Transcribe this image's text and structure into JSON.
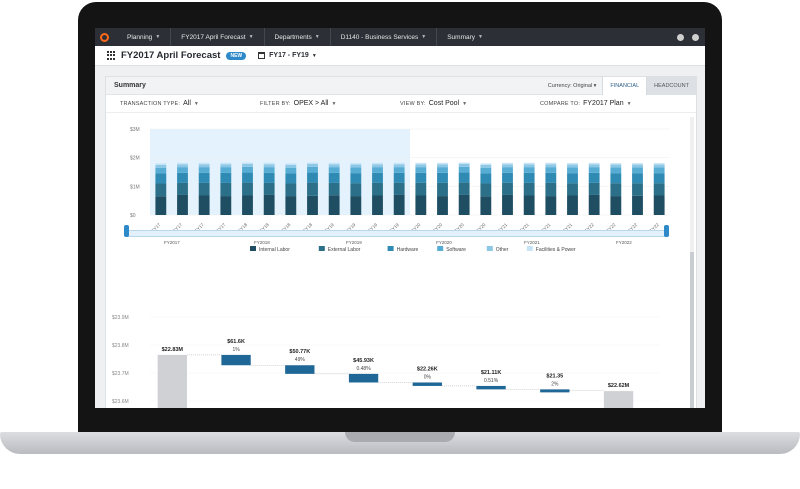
{
  "nav": {
    "items": [
      {
        "label": "Planning"
      },
      {
        "label": "FY2017 April Forecast"
      },
      {
        "label": "Departments"
      },
      {
        "label": "D1140 - Business Services"
      },
      {
        "label": "Summary"
      }
    ],
    "icons": [
      "settings-icon",
      "help-icon"
    ],
    "logo_color": "#ff6a1a"
  },
  "header": {
    "title": "FY2017 April Forecast",
    "badge": "NEW",
    "range": "FY17 - FY19"
  },
  "summary": {
    "title": "Summary",
    "currency": "Currency: Original",
    "tabs": [
      {
        "label": "FINANCIAL"
      },
      {
        "label": "HEADCOUNT"
      }
    ],
    "filters": [
      {
        "label": "TRANSACTION TYPE:",
        "value": "All"
      },
      {
        "label": "FILTER BY:",
        "value": "OPEX > All"
      },
      {
        "label": "VIEW BY:",
        "value": "Cost Pool"
      },
      {
        "label": "COMPARE TO:",
        "value": "FY2017 Plan"
      }
    ]
  },
  "timeline": {
    "labels": [
      "FY2017",
      "FY2018",
      "FY2019",
      "FY2020",
      "FY2021",
      "FY2022"
    ]
  },
  "chart_data": [
    {
      "type": "bar",
      "stacked": true,
      "categories": [
        "Q1 FY17",
        "Q2 FY17",
        "Q3 FY17",
        "Q4 FY17",
        "Q1 FY18",
        "Q2 FY18",
        "Q3 FY18",
        "Q4 FY18",
        "Q1 FY19",
        "Q2 FY19",
        "Q3 FY19",
        "Q4 FY19",
        "Q1 FY20",
        "Q2 FY20",
        "Q3 FY20",
        "Q4 FY20",
        "Q1 FY21",
        "Q2 FY21",
        "Q3 FY21",
        "Q4 FY21",
        "Q1 FY22",
        "Q2 FY22",
        "Q3 FY22",
        "Q4 FY22"
      ],
      "yticks": [
        "$3M",
        "$2M",
        "$1M",
        "$0"
      ],
      "ylim": [
        0,
        3
      ],
      "highlight_range": [
        "Q1 FY17",
        "Q4 FY19"
      ],
      "series": [
        {
          "name": "Internal Labor",
          "color": "#1f4e63",
          "values": [
            0.65,
            0.7,
            0.68,
            0.66,
            0.68,
            0.7,
            0.66,
            0.67,
            0.69,
            0.66,
            0.68,
            0.7,
            0.68,
            0.66,
            0.7,
            0.65,
            0.7,
            0.68,
            0.66,
            0.68,
            0.7,
            0.66,
            0.67,
            0.68
          ]
        },
        {
          "name": "External Labor",
          "color": "#2b6f88",
          "values": [
            0.45,
            0.42,
            0.44,
            0.46,
            0.45,
            0.42,
            0.44,
            0.46,
            0.43,
            0.45,
            0.44,
            0.42,
            0.44,
            0.46,
            0.43,
            0.45,
            0.42,
            0.44,
            0.46,
            0.43,
            0.42,
            0.45,
            0.44,
            0.43
          ]
        },
        {
          "name": "Hardware",
          "color": "#2f8bb3",
          "values": [
            0.35,
            0.35,
            0.35,
            0.35,
            0.35,
            0.35,
            0.35,
            0.35,
            0.35,
            0.35,
            0.35,
            0.35,
            0.35,
            0.35,
            0.35,
            0.35,
            0.35,
            0.35,
            0.35,
            0.35,
            0.35,
            0.35,
            0.35,
            0.35
          ]
        },
        {
          "name": "Software",
          "color": "#57acd4",
          "values": [
            0.2,
            0.2,
            0.2,
            0.2,
            0.2,
            0.2,
            0.2,
            0.2,
            0.2,
            0.2,
            0.2,
            0.2,
            0.2,
            0.2,
            0.2,
            0.2,
            0.2,
            0.2,
            0.2,
            0.2,
            0.2,
            0.2,
            0.2,
            0.2
          ]
        },
        {
          "name": "Other",
          "color": "#8dc7e6",
          "values": [
            0.1,
            0.1,
            0.1,
            0.1,
            0.1,
            0.1,
            0.1,
            0.1,
            0.1,
            0.1,
            0.1,
            0.1,
            0.1,
            0.1,
            0.1,
            0.1,
            0.1,
            0.1,
            0.1,
            0.1,
            0.1,
            0.1,
            0.1,
            0.1
          ]
        },
        {
          "name": "Facilities & Power",
          "color": "#c6e4f5",
          "values": [
            0.05,
            0.05,
            0.05,
            0.05,
            0.05,
            0.05,
            0.05,
            0.05,
            0.05,
            0.05,
            0.05,
            0.05,
            0.05,
            0.05,
            0.05,
            0.05,
            0.05,
            0.05,
            0.05,
            0.05,
            0.05,
            0.05,
            0.05,
            0.05
          ]
        }
      ]
    },
    {
      "type": "waterfall",
      "yticks": [
        "$23.9M",
        "$23.8M",
        "$23.7M",
        "$23.6M",
        "$23.5M"
      ],
      "ylim": [
        22.4,
        23.05
      ],
      "steps": [
        {
          "value": "$22.83M",
          "pct": "",
          "start": 22.83,
          "end": 22.4,
          "kind": "total"
        },
        {
          "value": "$61.6K",
          "pct": "1%",
          "start": 22.83,
          "end": 22.77,
          "kind": "delta"
        },
        {
          "value": "$50.77K",
          "pct": "49%",
          "start": 22.77,
          "end": 22.72,
          "kind": "delta"
        },
        {
          "value": "$45.93K",
          "pct": "0.48%",
          "start": 22.72,
          "end": 22.67,
          "kind": "delta"
        },
        {
          "value": "$22.26K",
          "pct": "0%",
          "start": 22.67,
          "end": 22.65,
          "kind": "delta"
        },
        {
          "value": "$21.11K",
          "pct": "0.51%",
          "start": 22.65,
          "end": 22.63,
          "kind": "delta"
        },
        {
          "value": "$21.35",
          "pct": "2%",
          "start": 22.63,
          "end": 22.625,
          "kind": "delta"
        },
        {
          "value": "$22.62M",
          "pct": "",
          "start": 22.62,
          "end": 22.4,
          "kind": "total"
        }
      ]
    }
  ]
}
